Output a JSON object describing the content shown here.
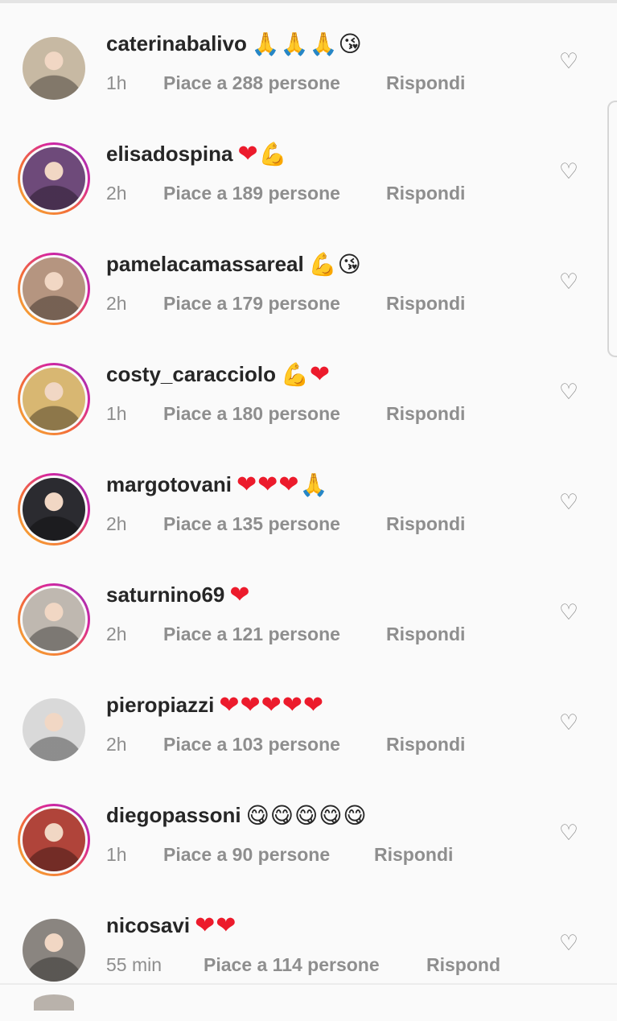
{
  "comments": [
    {
      "username": "caterinabalivo",
      "emojis": [
        "🙏",
        "🙏",
        "🙏",
        "😘"
      ],
      "time": "1h",
      "likes": "Piace a 288 persone",
      "reply": "Rispondi",
      "ring": "none",
      "avatar_color": "#c7b9a3"
    },
    {
      "username": "elisadospina",
      "emojis": [
        "❤",
        "💪"
      ],
      "time": "2h",
      "likes": "Piace a 189 persone",
      "reply": "Rispondi",
      "ring": "gradient",
      "avatar_color": "#6e4a7a"
    },
    {
      "username": "pamelacamassareal",
      "emojis": [
        "💪",
        "😘"
      ],
      "time": "2h",
      "likes": "Piace a 179 persone",
      "reply": "Rispondi",
      "ring": "gradient",
      "avatar_color": "#b59580"
    },
    {
      "username": "costy_caracciolo",
      "emojis": [
        "💪",
        "❤"
      ],
      "time": "1h",
      "likes": "Piace a 180 persone",
      "reply": "Rispondi",
      "ring": "gradient",
      "avatar_color": "#d8b772"
    },
    {
      "username": "margotovani",
      "emojis": [
        "❤",
        "❤",
        "❤",
        "🙏"
      ],
      "time": "2h",
      "likes": "Piace a 135 persone",
      "reply": "Rispondi",
      "ring": "gradient",
      "avatar_color": "#2b2b30"
    },
    {
      "username": "saturnino69",
      "emojis": [
        "❤"
      ],
      "time": "2h",
      "likes": "Piace a 121 persone",
      "reply": "Rispondi",
      "ring": "gradient",
      "avatar_color": "#bfb8b0"
    },
    {
      "username": "pieropiazzi",
      "emojis": [
        "❤",
        "❤",
        "❤",
        "❤",
        "❤"
      ],
      "time": "2h",
      "likes": "Piace a 103 persone",
      "reply": "Rispondi",
      "ring": "none",
      "avatar_color": "#d9d9d9"
    },
    {
      "username": "diegopassoni",
      "emojis": [
        "😋",
        "😋",
        "😋",
        "😋",
        "😋"
      ],
      "time": "1h",
      "likes": "Piace a 90 persone",
      "reply": "Rispondi",
      "ring": "gradient",
      "avatar_color": "#b0443a"
    },
    {
      "username": "nicosavi",
      "emojis": [
        "❤",
        "❤"
      ],
      "time": "55 min",
      "likes": "Piace a 114 persone",
      "reply": "Rispond",
      "ring": "none",
      "avatar_color": "#8a8580"
    }
  ],
  "icons": {
    "like": "heart-outline-icon"
  },
  "colors": {
    "heart": "#ec1b2c",
    "meta": "#8e8e8e",
    "text": "#262626"
  }
}
